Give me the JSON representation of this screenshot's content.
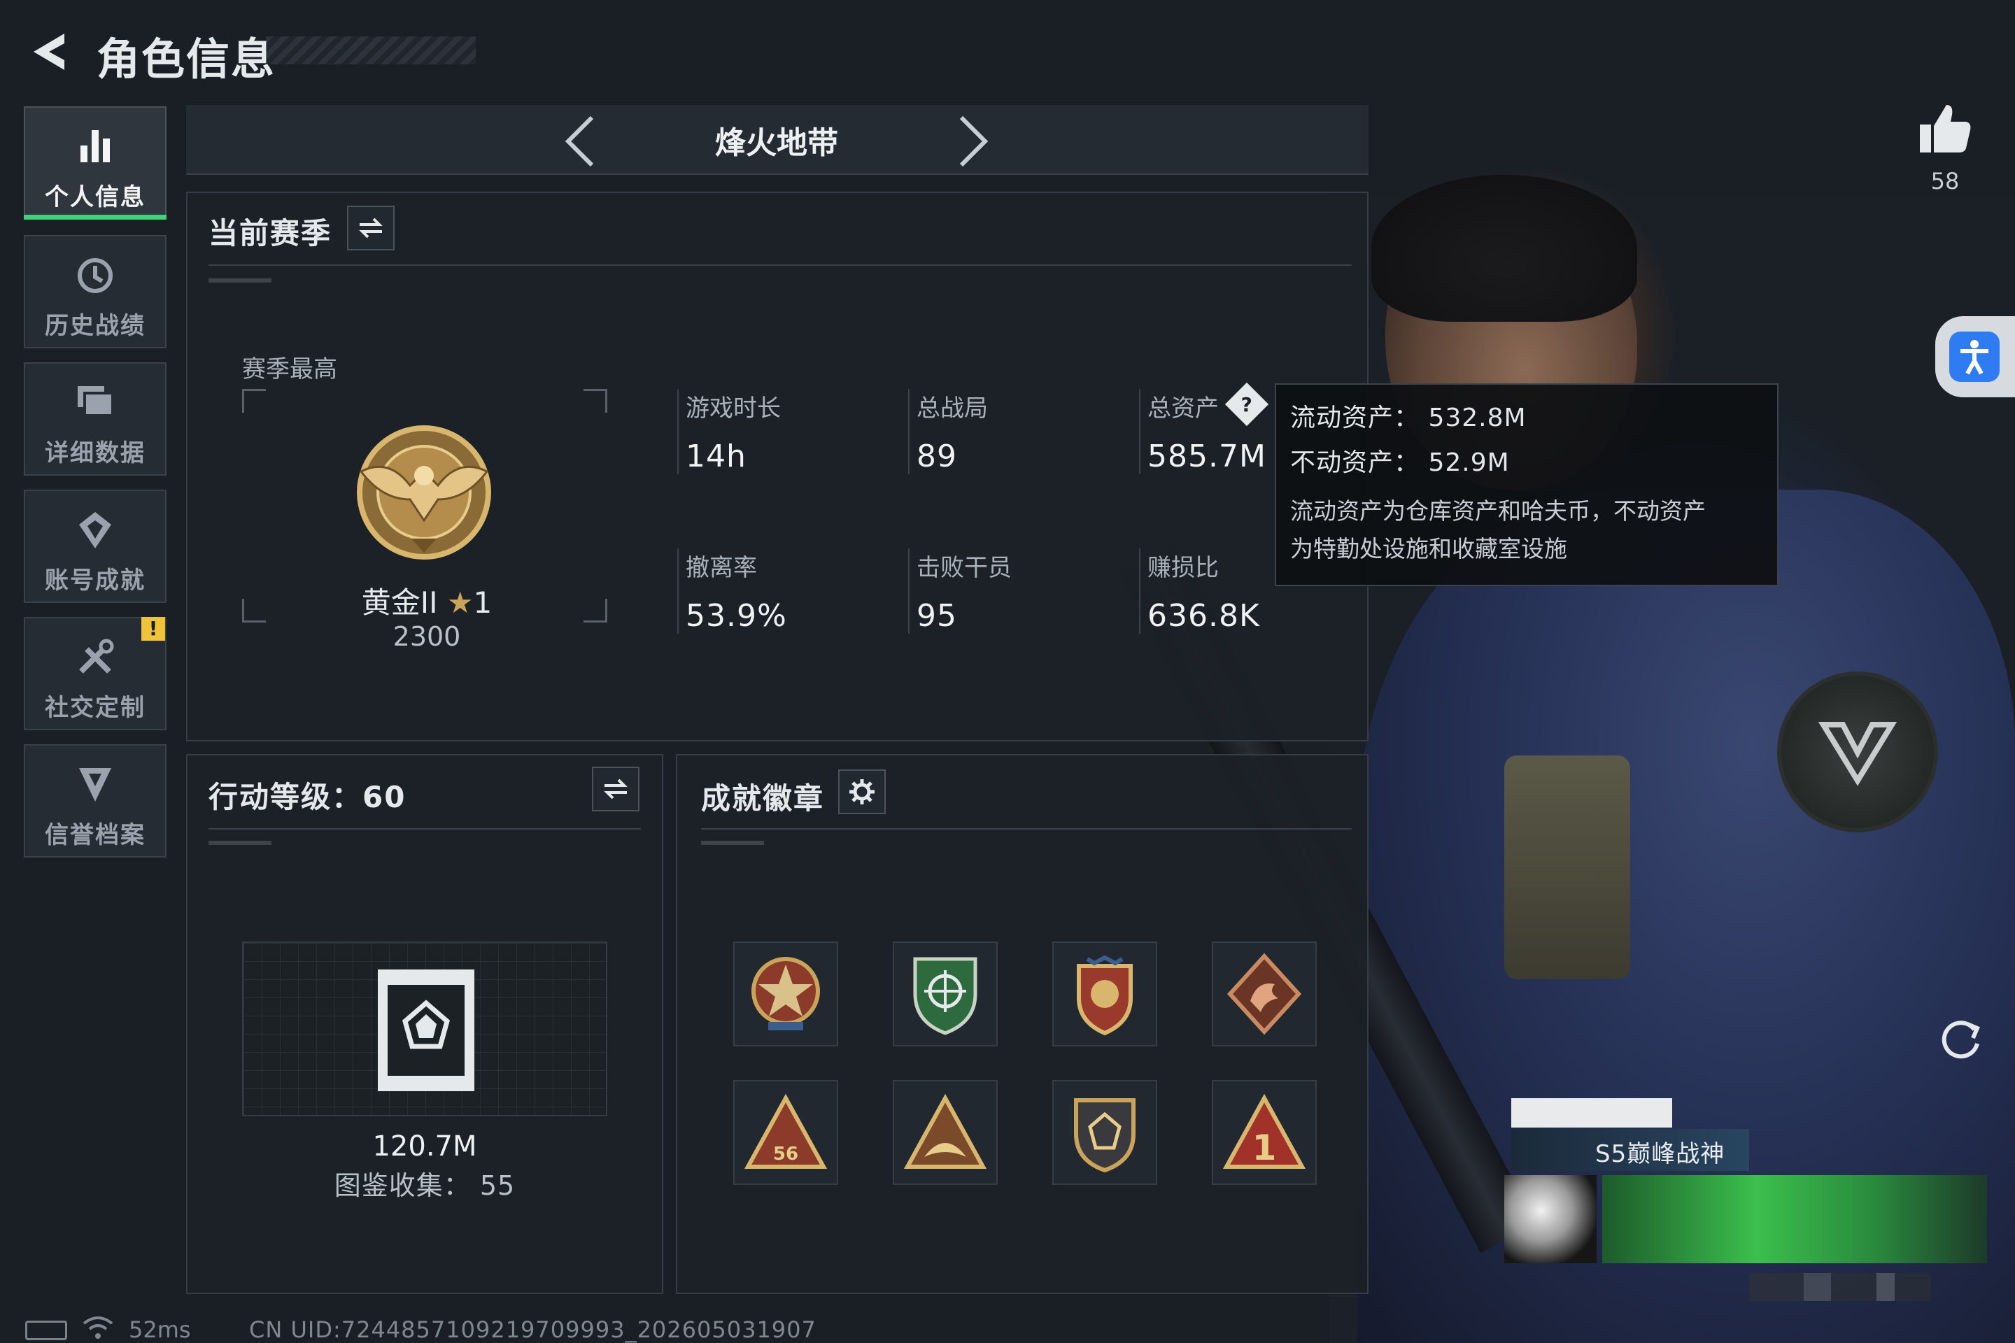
{
  "header": {
    "title": "角色信息"
  },
  "sidebar": {
    "items": [
      {
        "label": "个人信息",
        "icon": "bar-chart-icon",
        "active": true
      },
      {
        "label": "历史战绩",
        "icon": "history-clock-icon"
      },
      {
        "label": "详细数据",
        "icon": "detail-data-icon"
      },
      {
        "label": "账号成就",
        "icon": "achievement-icon"
      },
      {
        "label": "社交定制",
        "icon": "tools-icon",
        "badge": "!"
      },
      {
        "label": "信誉档案",
        "icon": "reputation-shield-icon"
      }
    ]
  },
  "mode": {
    "title": "烽火地带"
  },
  "season": {
    "title": "当前赛季",
    "best_label": "赛季最高",
    "rank_name": "黄金II",
    "rank_stars": "1",
    "rank_score": "2300",
    "stats": [
      {
        "label": "游戏时长",
        "value": "14h"
      },
      {
        "label": "总战局",
        "value": "89"
      },
      {
        "label": "总资产",
        "value": "585.7M",
        "help": true
      },
      {
        "label": "撤离率",
        "value": "53.9%"
      },
      {
        "label": "击败干员",
        "value": "95"
      },
      {
        "label": "赚损比",
        "value": "636.8K"
      }
    ]
  },
  "tooltip": {
    "liquid": "流动资产：  532.8M",
    "fixed": "不动资产：  52.9M",
    "note_line1": "流动资产为仓库资产和哈夫币，不动资产",
    "note_line2": "为特勤处设施和收藏室设施"
  },
  "level": {
    "title": "行动等级：60",
    "value": "120.7M",
    "collect": "图鉴收集：  55"
  },
  "badges": {
    "title": "成就徽章",
    "items": [
      "star-medal-icon",
      "green-crosshair-shield-icon",
      "eagle-crest-icon",
      "dragon-diamond-icon",
      "triangle-56-icon",
      "triangle-wing-icon",
      "dark-shield-icon",
      "triangle-one-icon"
    ]
  },
  "profile": {
    "likes": "58",
    "card_title": "S5巅峰战神"
  },
  "footer": {
    "ping": "52ms",
    "uid": "CN UID:7244857109219709993_202605031907"
  },
  "colors": {
    "accent_green": "#3fd37a",
    "warn_yellow": "#f0c33c",
    "gold": "#c9a45a",
    "access_blue": "#2f7cf2"
  }
}
